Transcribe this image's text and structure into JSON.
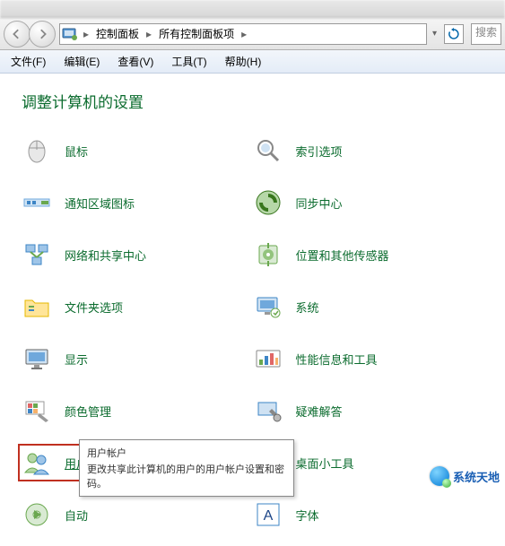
{
  "breadcrumb": {
    "root_icon": "control-panel",
    "crumb1": "控制面板",
    "crumb2": "所有控制面板项"
  },
  "search": {
    "placeholder": "搜索"
  },
  "menu": {
    "file": "文件(F)",
    "edit": "编辑(E)",
    "view": "查看(V)",
    "tools": "工具(T)",
    "help": "帮助(H)"
  },
  "heading": "调整计算机的设置",
  "items": {
    "left": [
      {
        "key": "mouse",
        "label": "鼠标"
      },
      {
        "key": "notification-area",
        "label": "通知区域图标"
      },
      {
        "key": "network-sharing",
        "label": "网络和共享中心"
      },
      {
        "key": "folder-options",
        "label": "文件夹选项"
      },
      {
        "key": "display",
        "label": "显示"
      },
      {
        "key": "color-management",
        "label": "颜色管理"
      },
      {
        "key": "user-accounts",
        "label": "用户帐户"
      },
      {
        "key": "autoplay",
        "label": "自动"
      }
    ],
    "right": [
      {
        "key": "indexing",
        "label": "索引选项"
      },
      {
        "key": "sync-center",
        "label": "同步中心"
      },
      {
        "key": "location-sensors",
        "label": "位置和其他传感器"
      },
      {
        "key": "system",
        "label": "系统"
      },
      {
        "key": "performance",
        "label": "性能信息和工具"
      },
      {
        "key": "troubleshoot",
        "label": "疑难解答"
      },
      {
        "key": "gadgets",
        "label": "桌面小工具"
      },
      {
        "key": "fonts",
        "label": "字体"
      }
    ]
  },
  "tooltip": {
    "title": "用户帐户",
    "body": "更改共享此计算机的用户的用户帐户设置和密码。"
  },
  "watermark": "系统天地"
}
